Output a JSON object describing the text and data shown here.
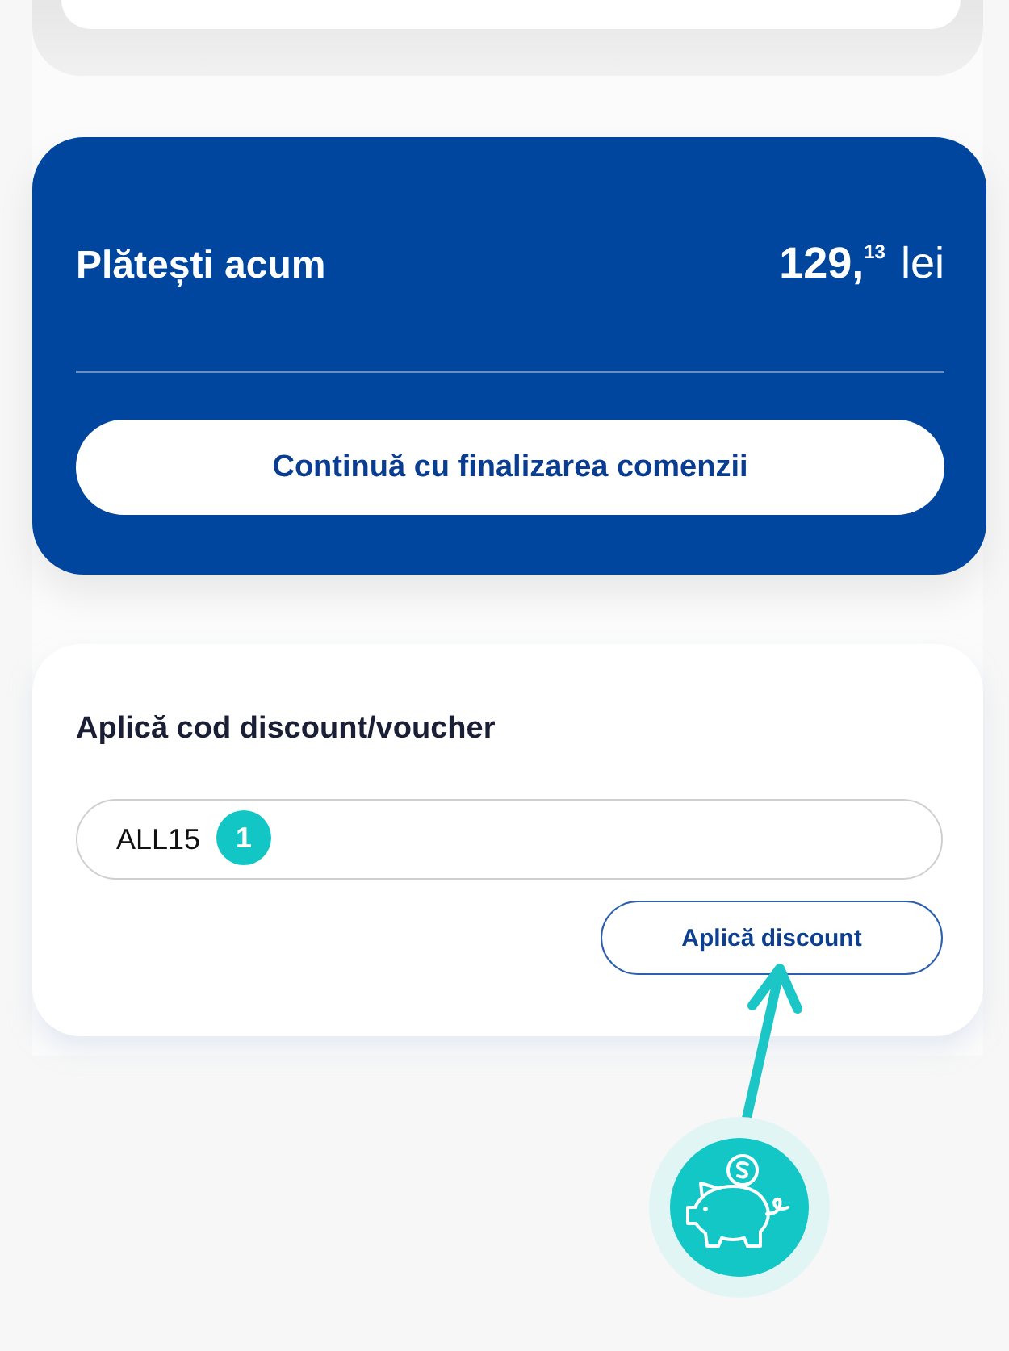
{
  "payment": {
    "label": "Plătești acum",
    "price": "**129,**$^{13}$ lei",
    "button": "Continuă cu finalizarea comenzii"
  },
  "discount": {
    "title": "Aplică cod discount/voucher",
    "code_field": {
      "value": "ALL15"
    },
    "step_badge": "1",
    "button": "Aplică discount"
  }
}
